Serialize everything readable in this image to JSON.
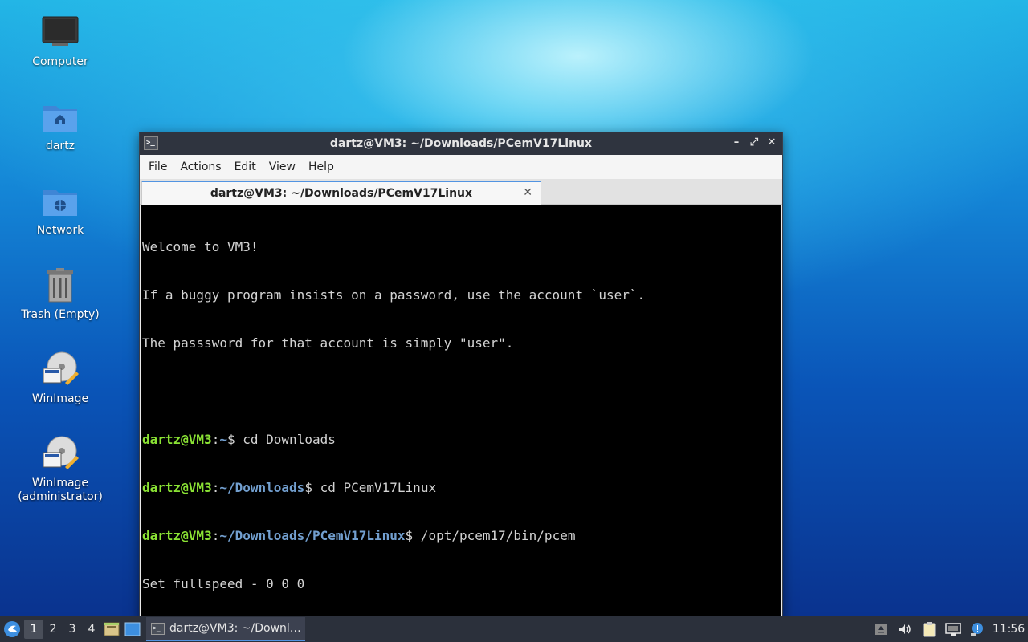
{
  "desktop": {
    "icons": [
      {
        "label": "Computer",
        "icon": "computer-icon"
      },
      {
        "label": "dartz",
        "icon": "home-folder-icon"
      },
      {
        "label": "Network",
        "icon": "network-folder-icon"
      },
      {
        "label": "Trash (Empty)",
        "icon": "trash-icon"
      },
      {
        "label": "WinImage",
        "icon": "winimage-icon"
      },
      {
        "label": "WinImage\n(administrator)",
        "icon": "winimage-admin-icon"
      }
    ]
  },
  "window": {
    "title": "dartz@VM3: ~/Downloads/PCemV17Linux",
    "buttons": {
      "minimize": "–",
      "maximize": "⤢",
      "close": "✕"
    },
    "menu": [
      "File",
      "Actions",
      "Edit",
      "View",
      "Help"
    ],
    "tab": {
      "label": "dartz@VM3: ~/Downloads/PCemV17Linux",
      "close": "✕"
    },
    "terminal": {
      "welcome": [
        "Welcome to VM3!",
        "If a buggy program insists on a password, use the account `user`.",
        "The passsword for that account is simply \"user\"."
      ],
      "commands": [
        {
          "user": "dartz@VM3",
          "path": "~",
          "cmd": " cd Downloads"
        },
        {
          "user": "dartz@VM3",
          "path": "~/Downloads",
          "cmd": " cd PCemV17Linux"
        },
        {
          "user": "dartz@VM3",
          "path": "~/Downloads/PCemV17Linux",
          "cmd": " /opt/pcem17/bin/pcem"
        }
      ],
      "output": "Set fullspeed - 0 0 0"
    }
  },
  "taskbar": {
    "workspaces": [
      "1",
      "2",
      "3",
      "4"
    ],
    "active_workspace": "1",
    "task": {
      "label": "dartz@VM3: ~/Downl…"
    },
    "clock": "11:56",
    "colors": {
      "accent": "#5294e2",
      "prompt_user": "#8ae234",
      "prompt_path": "#729fcf"
    }
  }
}
